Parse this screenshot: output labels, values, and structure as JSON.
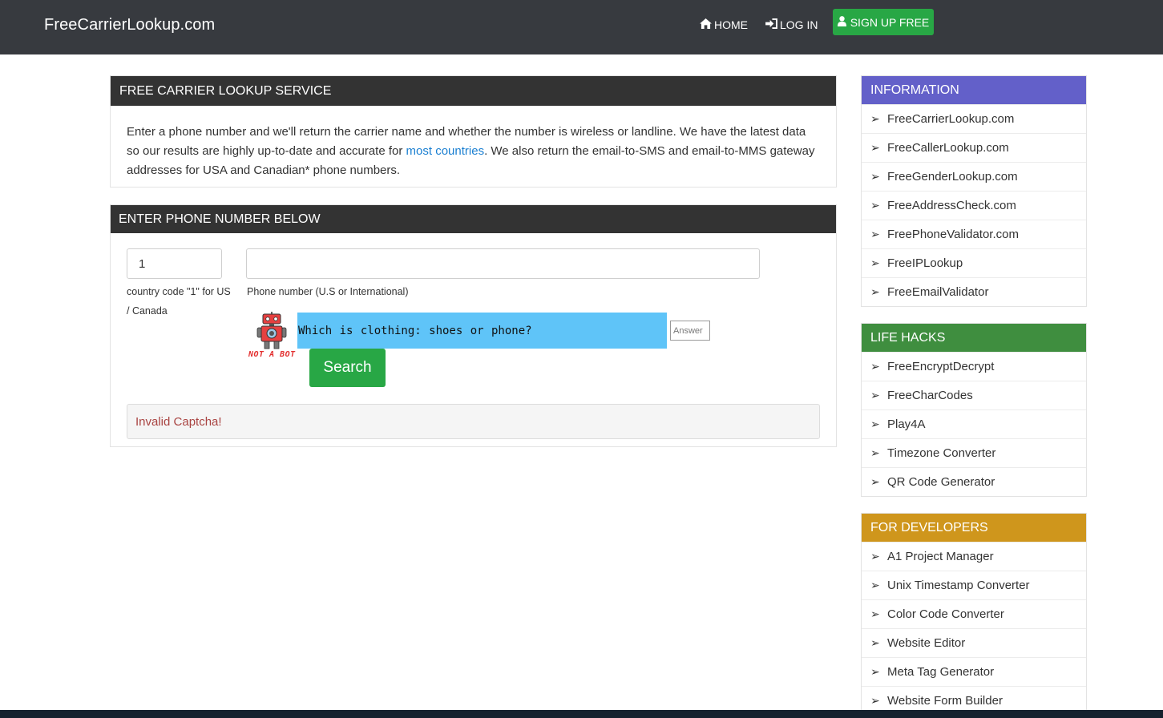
{
  "navbar": {
    "brand": "FreeCarrierLookup.com",
    "home_label": "HOME",
    "login_label": "LOG IN",
    "signup_label": "SIGN UP FREE",
    "signup_color": "#28a745"
  },
  "intro": {
    "title": "FREE CARRIER LOOKUP SERVICE",
    "text_before": "Enter a phone number and we'll return the carrier name and whether the number is wireless or landline. We have the latest data so our results are highly up-to-date and accurate for ",
    "link_text": "most countries",
    "text_after": ". We also return the email-to-SMS and email-to-MMS gateway addresses for USA and Canadian* phone numbers."
  },
  "form": {
    "title": "ENTER PHONE NUMBER BELOW",
    "country_code_value": "1",
    "country_code_help": "country code \"1\" for US / Canada",
    "phone_value": "",
    "phone_help": "Phone number (U.S or International)",
    "robot_caption": "NOT A BOT",
    "captcha_question": "Which is clothing: shoes or phone?",
    "answer_placeholder": "Answer",
    "search_label": "Search",
    "error_message": "Invalid Captcha!"
  },
  "sidebar": {
    "information": {
      "title": "INFORMATION",
      "color": "#6360c9",
      "items": [
        "FreeCarrierLookup.com",
        "FreeCallerLookup.com",
        "FreeGenderLookup.com",
        "FreeAddressCheck.com",
        "FreePhoneValidator.com",
        "FreeIPLookup",
        "FreeEmailValidator"
      ]
    },
    "life_hacks": {
      "title": "LIFE HACKS",
      "color": "#3f8e3f",
      "items": [
        "FreeEncryptDecrypt",
        "FreeCharCodes",
        "Play4A",
        "Timezone Converter",
        "QR Code Generator"
      ]
    },
    "developers": {
      "title": "FOR DEVELOPERS",
      "color": "#cf961c",
      "items": [
        "A1 Project Manager",
        "Unix Timestamp Converter",
        "Color Code Converter",
        "Website Editor",
        "Meta Tag Generator",
        "Website Form Builder"
      ]
    },
    "arrow_glyph": "➢"
  }
}
